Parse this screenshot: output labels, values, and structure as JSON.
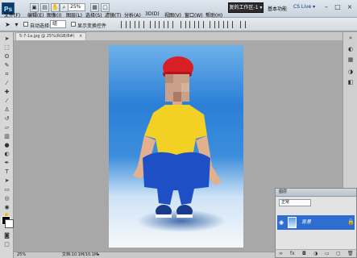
{
  "app": {
    "logo": "Ps"
  },
  "menubar": {
    "items": [
      "文件(F)",
      "编辑(E)",
      "图像(I)",
      "图层(L)",
      "选择(S)",
      "滤镜(T)",
      "分析(A)",
      "3D(D)",
      "视图(V)",
      "窗口(W)",
      "帮助(H)"
    ],
    "zoom": "25%",
    "workspace_active": "复的工作区-1 ▾",
    "workspace_links": [
      "基本功能",
      "设计"
    ],
    "cs_live": "CS Live ▾",
    "window_controls": [
      "–",
      "□",
      "×"
    ]
  },
  "options": {
    "auto_select_label": "自动选择:",
    "auto_select_value": "组",
    "show_transform_label": "显示变换控件"
  },
  "document": {
    "tab_label": "5-7-1a.jpg @ 25%(RGB/8#)",
    "tab_close": "×"
  },
  "status": {
    "zoom": "25%",
    "doc_info": "文档:10.1M/10.1M",
    "arrow": "▸"
  },
  "layers_panel": {
    "title": "图层",
    "blend_mode": "正常",
    "layer_name": "背景",
    "layer_visible_icon": "eye-icon",
    "layer_lock_icon": "lock-icon"
  },
  "colors": {
    "accent": "#2f6dd0",
    "workspace_bg": "#2c2c2c"
  }
}
